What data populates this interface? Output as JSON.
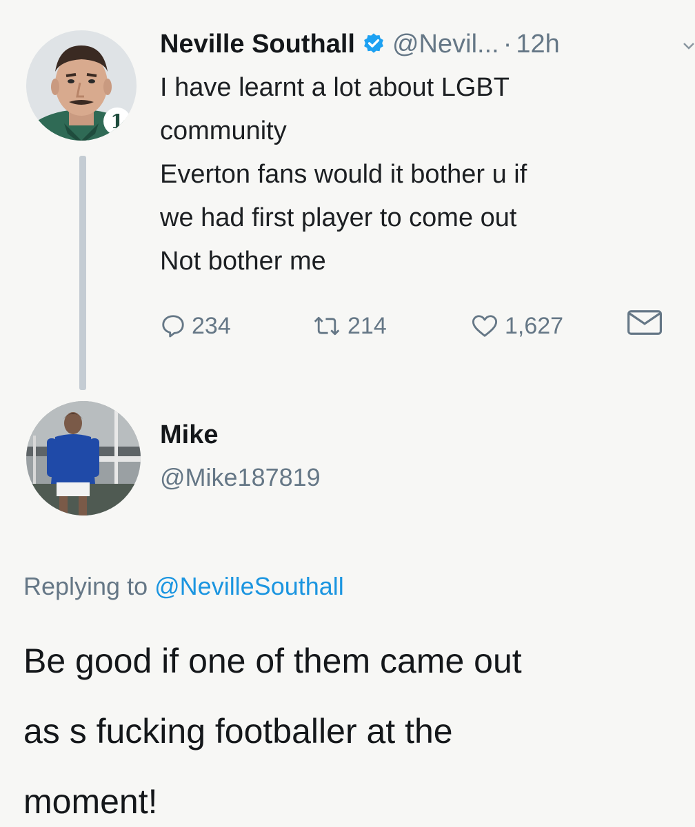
{
  "original_tweet": {
    "display_name": "Neville Southall",
    "handle": "@Nevil...",
    "separator": "·",
    "time": "12h",
    "avatar_icon": "goalkeeper-portrait-avatar",
    "verified_icon": "verified-badge-icon",
    "text_lines": [
      "I have learnt a lot about LGBT",
      "community",
      "Everton fans would it bother u if",
      "we had first player to come out",
      "Not bother me"
    ],
    "actions": {
      "reply_count": "234",
      "retweet_count": "214",
      "like_count": "1,627",
      "reply_icon": "reply-bubble-icon",
      "retweet_icon": "retweet-icon",
      "like_icon": "heart-icon",
      "dm_icon": "envelope-icon"
    }
  },
  "reply_tweet": {
    "display_name": "Mike",
    "handle": "@Mike187819",
    "avatar_icon": "footballer-photo-avatar",
    "replying_to_prefix": "Replying to",
    "replying_to_handle": "@NevilleSouthall",
    "text_lines": [
      "Be good if one of them came out",
      "as s fucking footballer at the",
      "moment!"
    ]
  },
  "colors": {
    "background": "#f7f7f5",
    "text_primary": "#14171a",
    "text_secondary": "#657786",
    "link_blue": "#1b95e0",
    "verified_blue": "#1da1f2",
    "thread_line": "#c4ccd3"
  }
}
